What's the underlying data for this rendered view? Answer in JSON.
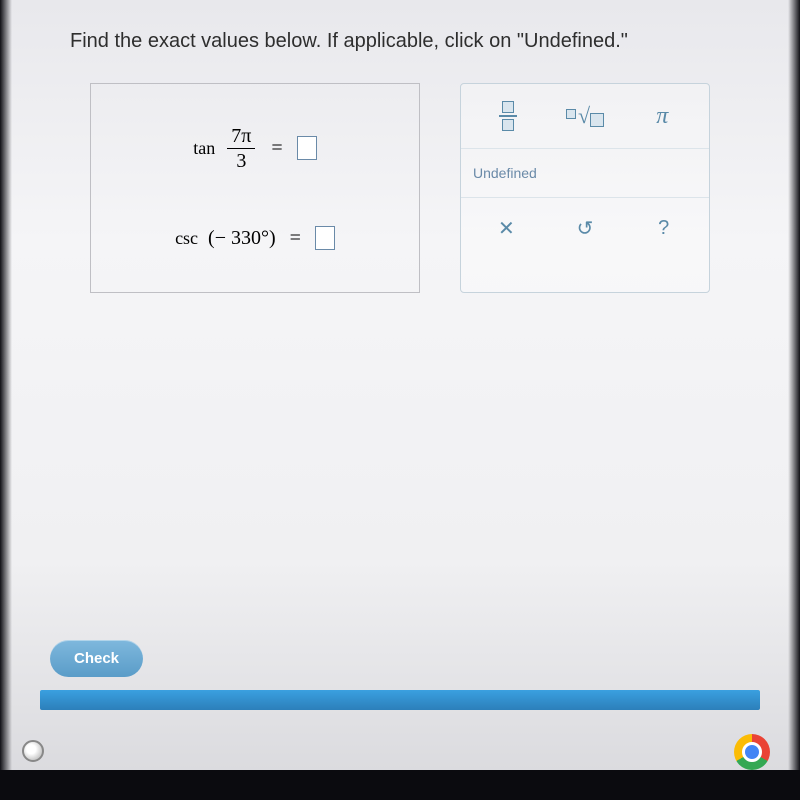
{
  "instruction": "Find the exact values below. If applicable, click on \"Undefined.\"",
  "problems": {
    "p1": {
      "fn": "tan",
      "arg_num": "7π",
      "arg_den": "3",
      "eq": "="
    },
    "p2": {
      "fn": "csc",
      "arg": "(− 330°)",
      "eq": "="
    }
  },
  "tools": {
    "fraction": "fraction",
    "sqrt_lead": "□",
    "pi": "π",
    "undefined": "Undefined",
    "clear": "✕",
    "reset": "↺",
    "help": "?"
  },
  "check": "Check"
}
